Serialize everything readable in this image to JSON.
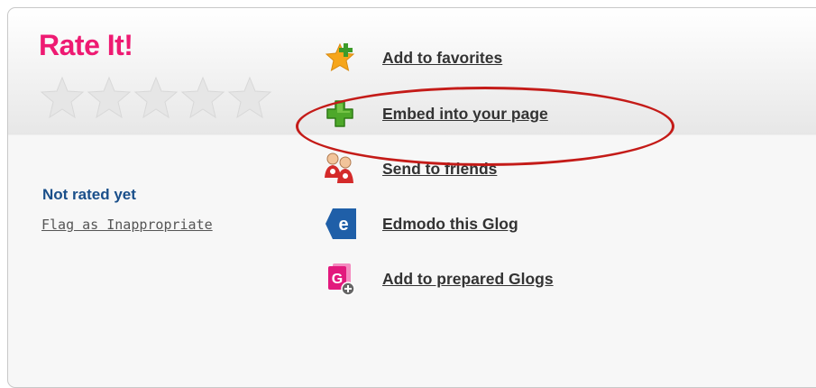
{
  "rating": {
    "title": "Rate It!",
    "stars_total": 5,
    "stars_filled": 0,
    "status": "Not rated yet",
    "flag_label": "Flag as Inappropriate"
  },
  "actions": [
    {
      "label": "Add to favorites",
      "icon": "star-plus-icon"
    },
    {
      "label": "Embed into your page",
      "icon": "green-plus-icon"
    },
    {
      "label": "Send to friends",
      "icon": "friends-icon"
    },
    {
      "label": "Edmodo this Glog",
      "icon": "edmodo-icon"
    },
    {
      "label": "Add to prepared Glogs",
      "icon": "glog-add-icon"
    }
  ],
  "colors": {
    "title": "#ee1a72",
    "status": "#1a4f8a",
    "highlight": "#c41b18",
    "edmodo": "#1f5fa8"
  }
}
